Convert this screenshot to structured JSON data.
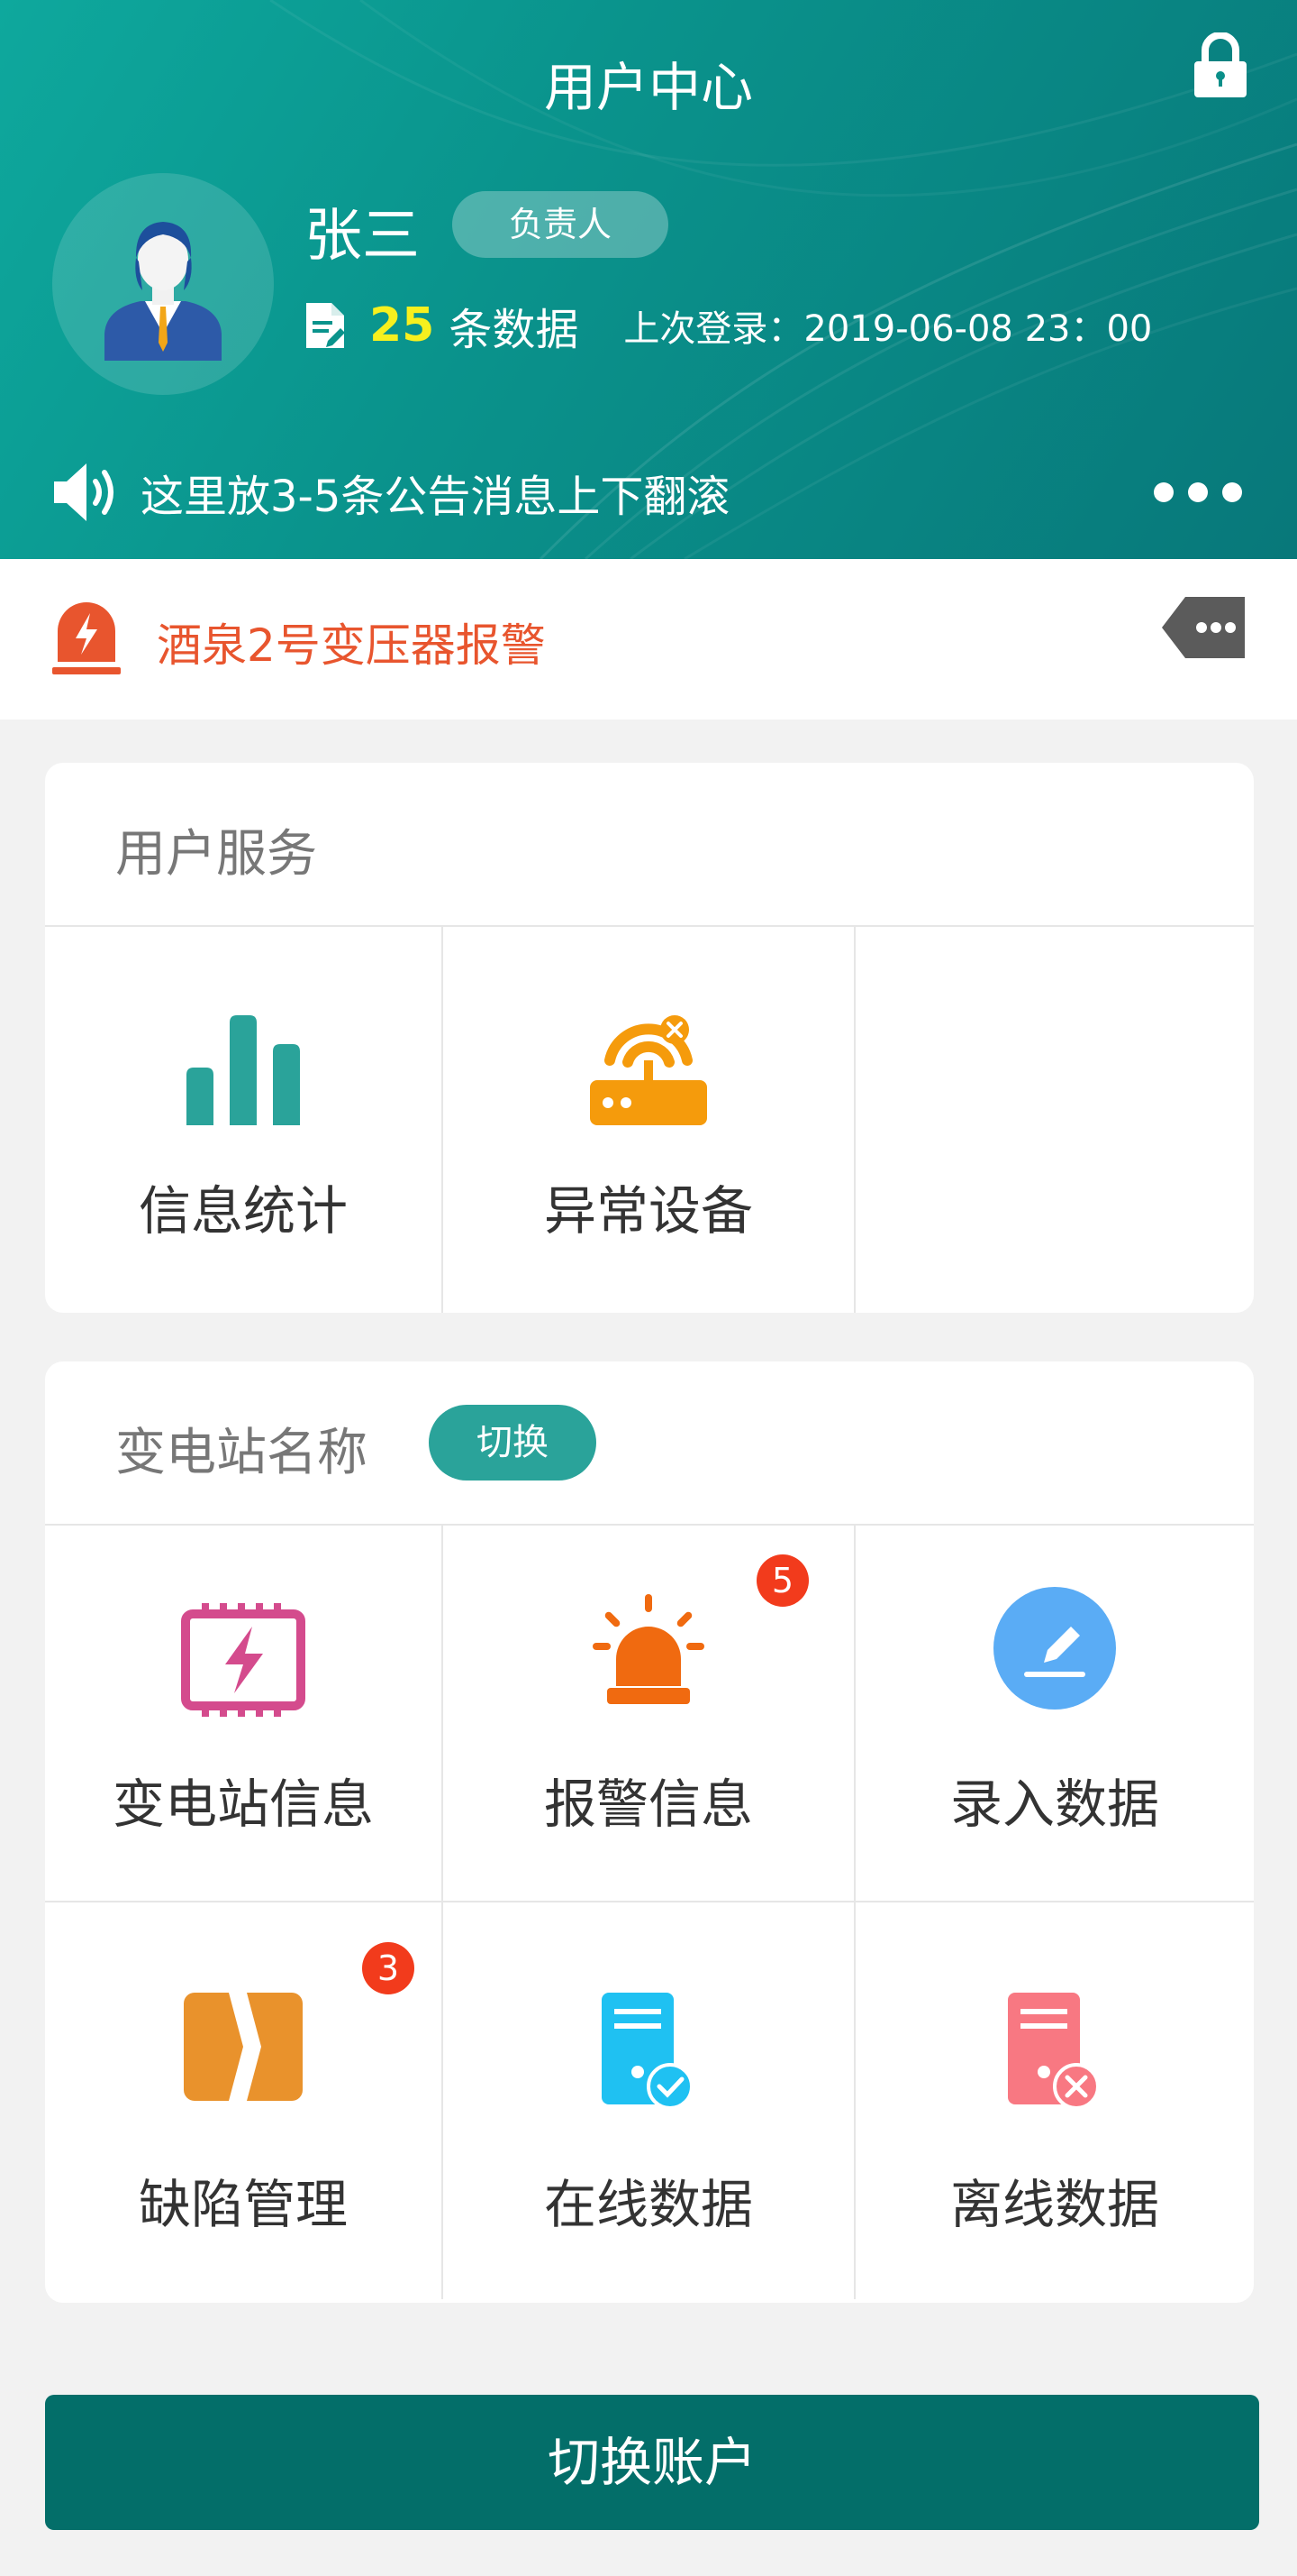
{
  "header": {
    "title": "用户中心",
    "user_name": "张三",
    "role": "负责人",
    "data_count": "25",
    "data_unit": "条数据",
    "last_login_label": "上次登录：",
    "last_login_value": "2019-06-08 23：00",
    "notice": "这里放3-5条公告消息上下翻滚"
  },
  "alarm": {
    "text": "酒泉2号变压器报警"
  },
  "user_service": {
    "title": "用户服务",
    "items": [
      {
        "label": "信息统计",
        "icon": "bar-chart-icon"
      },
      {
        "label": "异常设备",
        "icon": "router-error-icon"
      }
    ]
  },
  "station": {
    "title": "变电站名称",
    "switch_label": "切换",
    "items": [
      {
        "label": "变电站信息",
        "icon": "substation-icon"
      },
      {
        "label": "报警信息",
        "icon": "alarm-light-icon",
        "badge": "5"
      },
      {
        "label": "录入数据",
        "icon": "edit-icon"
      },
      {
        "label": "缺陷管理",
        "icon": "chevron-right-icon",
        "badge": "3"
      },
      {
        "label": "在线数据",
        "icon": "server-online-icon"
      },
      {
        "label": "离线数据",
        "icon": "server-offline-icon"
      }
    ]
  },
  "footer": {
    "switch_account_label": "切换账户"
  },
  "colors": {
    "teal": "#0a938c",
    "dark_teal": "#036e69",
    "badge_red": "#f23b1c",
    "alarm_orange": "#e8552e"
  }
}
